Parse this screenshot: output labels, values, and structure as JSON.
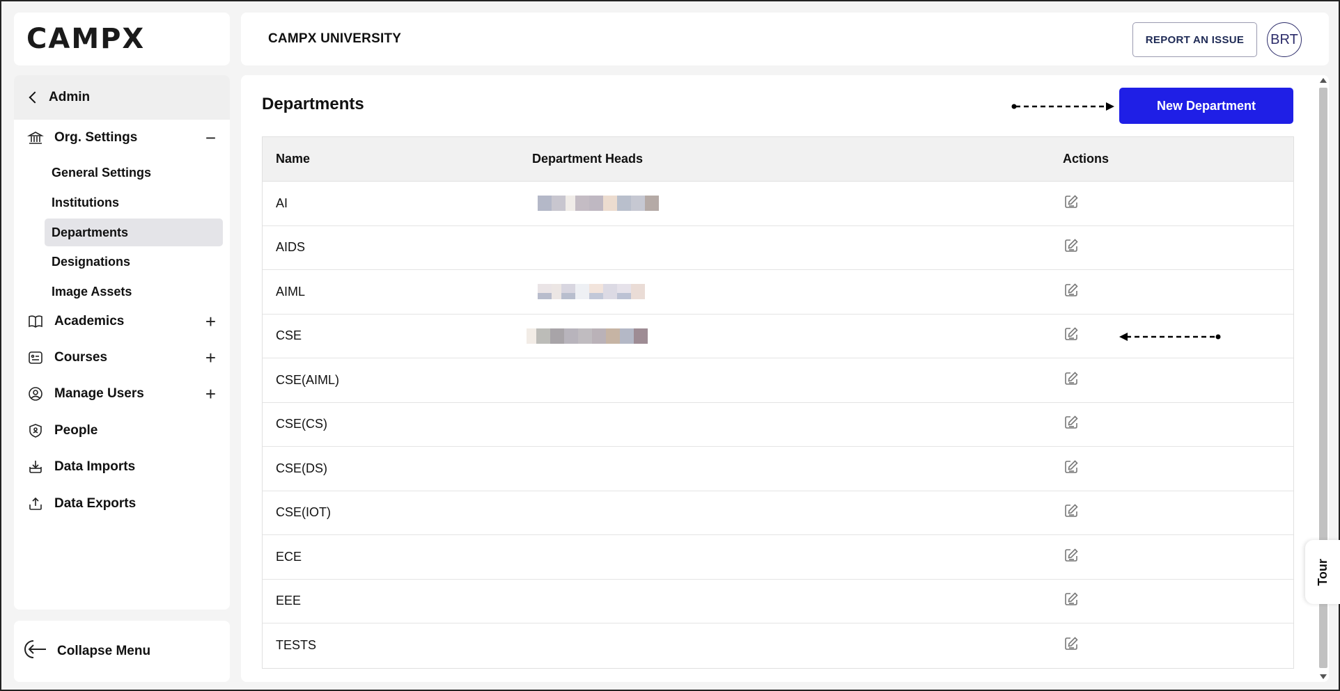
{
  "brand": {
    "logo": "CAMPX"
  },
  "header": {
    "title": "CAMPX UNIVERSITY",
    "report_label": "REPORT AN ISSUE",
    "avatar_initials": "BRT"
  },
  "sidebar": {
    "back_label": "Admin",
    "sections": [
      {
        "label": "Org. Settings",
        "icon": "bank-icon",
        "toggle": "−"
      },
      {
        "label": "Academics",
        "icon": "book-icon",
        "toggle": "+"
      },
      {
        "label": "Courses",
        "icon": "courses-icon",
        "toggle": "+"
      },
      {
        "label": "Manage Users",
        "icon": "user-circle-icon",
        "toggle": "+"
      },
      {
        "label": "People",
        "icon": "people-shield-icon"
      },
      {
        "label": "Data Imports",
        "icon": "import-icon"
      },
      {
        "label": "Data Exports",
        "icon": "export-icon"
      }
    ],
    "org_items": [
      "General Settings",
      "Institutions",
      "Departments",
      "Designations",
      "Image Assets"
    ],
    "active_item": "Departments",
    "collapse_label": "Collapse Menu"
  },
  "main": {
    "title": "Departments",
    "new_button": "New Department",
    "table": {
      "columns": [
        "Name",
        "Department Heads",
        "Actions"
      ],
      "rows": [
        {
          "name": "AI"
        },
        {
          "name": "AIDS"
        },
        {
          "name": "AIML"
        },
        {
          "name": "CSE"
        },
        {
          "name": "CSE(AIML)"
        },
        {
          "name": "CSE(CS)"
        },
        {
          "name": "CSE(DS)"
        },
        {
          "name": "CSE(IOT)"
        },
        {
          "name": "ECE"
        },
        {
          "name": "EEE"
        },
        {
          "name": "TESTS"
        }
      ]
    }
  },
  "tour_label": "Tour",
  "colors": {
    "primary": "#1f1fe6",
    "active_bg": "#e4e4e8"
  }
}
